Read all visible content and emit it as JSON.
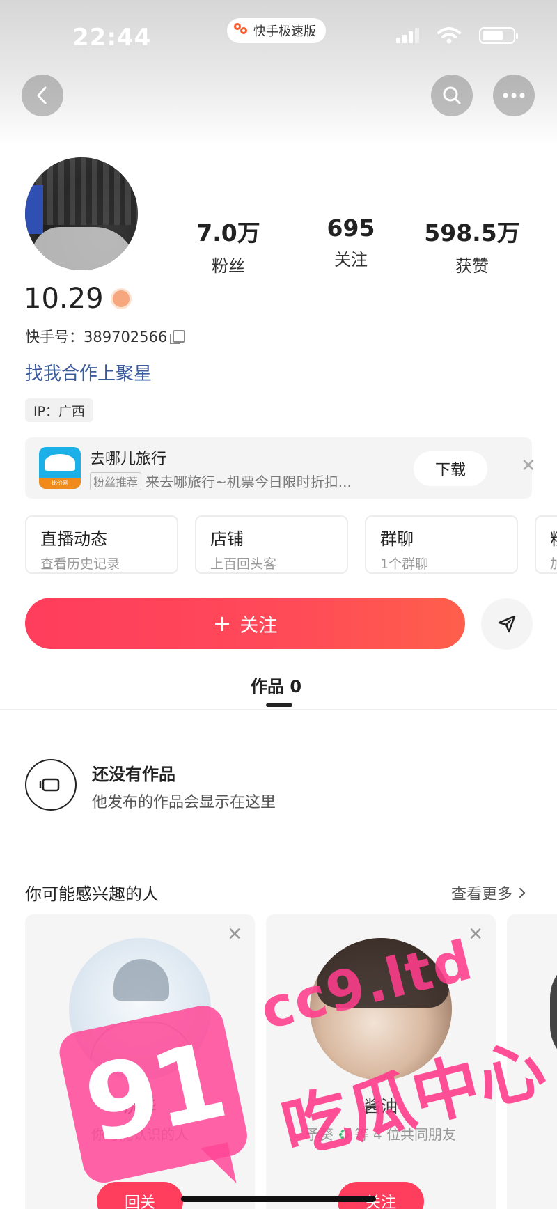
{
  "status_bar": {
    "time": "22:44",
    "app_name": "快手极速版"
  },
  "nav": {
    "back_icon": "chevron-left-icon",
    "search_icon": "search-icon",
    "more_icon": "more-icon"
  },
  "profile": {
    "stats": [
      {
        "value": "7.0万",
        "label": "粉丝"
      },
      {
        "value": "695",
        "label": "关注"
      },
      {
        "value": "598.5万",
        "label": "获赞"
      }
    ],
    "nickname": "10.29",
    "kuaishou_id": "快手号：389702566",
    "link": "找我合作上聚星",
    "ip": "IP：广西"
  },
  "ad": {
    "title": "去哪儿旅行",
    "tag": "粉丝推荐",
    "subtitle": "来去哪旅行~机票今日限时折扣...",
    "icon_caption": "比价网",
    "download_label": "下载",
    "close": "✕"
  },
  "features": [
    {
      "title": "直播动态",
      "sub": "查看历史记录"
    },
    {
      "title": "店铺",
      "sub": "上百回头客"
    },
    {
      "title": "群聊",
      "sub": "1个群聊"
    },
    {
      "title": "粉",
      "sub": "加"
    }
  ],
  "follow": {
    "label": "关注",
    "plus": "+"
  },
  "tabs": {
    "works": "作品 0"
  },
  "empty": {
    "title": "还没有作品",
    "subtitle": "他发布的作品会显示在这里"
  },
  "suggestions": {
    "title": "你可能感兴趣的人",
    "more": "查看更多",
    "cards": [
      {
        "name": "浣华",
        "desc": "你可能认识的人",
        "button": "回关"
      },
      {
        "name": "酱油",
        "desc_pre": "予葵",
        "desc_post": "等 4 位共同朋友",
        "button": "关注"
      }
    ]
  },
  "watermark": {
    "number": "91",
    "url": "cc9.ltd",
    "text": "吃瓜中心"
  }
}
